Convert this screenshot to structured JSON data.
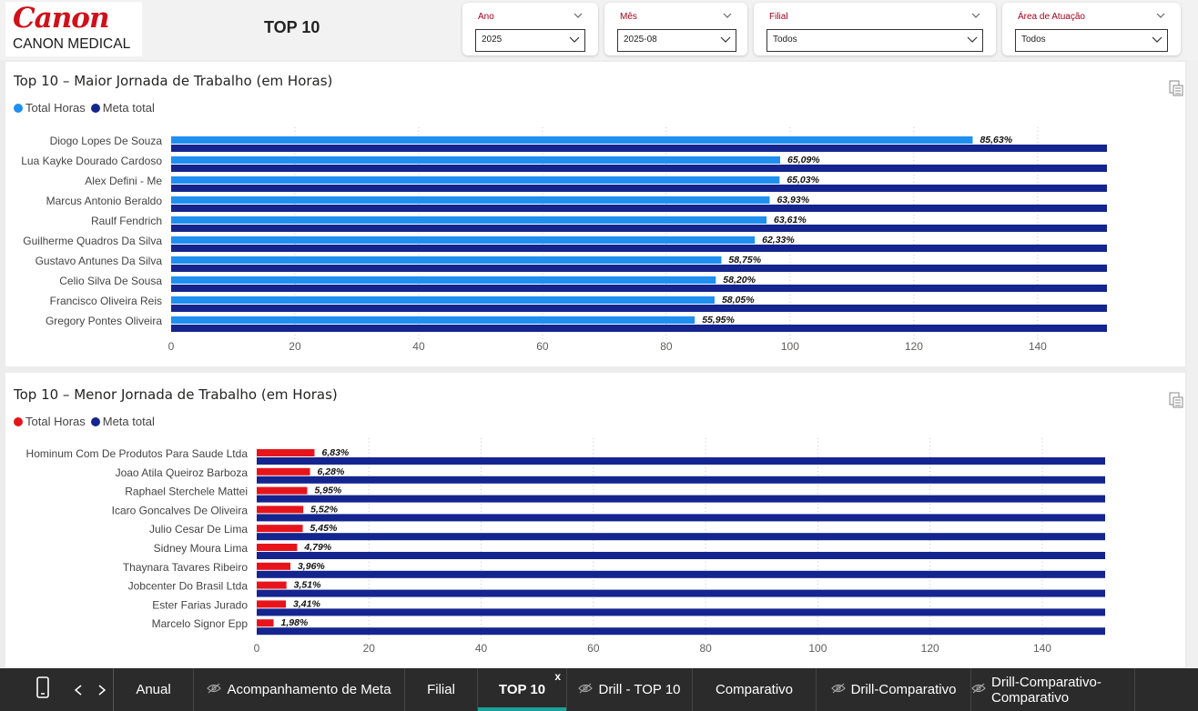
{
  "header": {
    "logo_brand": "Canon",
    "logo_sub": "CANON MEDICAL",
    "page_title": "TOP 10"
  },
  "filters": [
    {
      "label": "Ano",
      "value": "2025"
    },
    {
      "label": "Mês",
      "value": "2025-08"
    },
    {
      "label": "Filial",
      "value": "Todos"
    },
    {
      "label": "Área de Atuação",
      "value": "Todos"
    }
  ],
  "charts": {
    "top": {
      "title": "Top 10 – Maior Jornada de Trabalho (em Horas)",
      "legend": [
        "Total Horas",
        "Meta total"
      ]
    },
    "bottom": {
      "title": "Top 10 – Menor Jornada de Trabalho (em Horas)",
      "legend": [
        "Total Horas",
        "Meta total"
      ]
    }
  },
  "chart_data": [
    {
      "type": "bar",
      "orientation": "horizontal",
      "title": "Top 10 – Maior Jornada de Trabalho (em Horas)",
      "categories": [
        "Diogo Lopes De Souza",
        "Lua Kayke Dourado Cardoso",
        "Alex Defini - Me",
        "Marcus Antonio Beraldo",
        "Raulf Fendrich",
        "Guilherme Quadros Da Silva",
        "Gustavo Antunes Da Silva",
        "Celio Silva De Sousa",
        "Francisco Oliveira Reis",
        "Gregory Pontes Oliveira"
      ],
      "series": [
        {
          "name": "Total Horas",
          "color": "#1f8ff0",
          "values": [
            129.5,
            98.4,
            98.3,
            96.7,
            96.2,
            94.3,
            88.9,
            88.0,
            87.8,
            84.6
          ]
        },
        {
          "name": "Meta total",
          "color": "#14258f",
          "values": [
            151.2,
            151.2,
            151.2,
            151.2,
            151.2,
            151.2,
            151.2,
            151.2,
            151.2,
            151.2
          ]
        }
      ],
      "data_labels": [
        "85,63%",
        "65,09%",
        "65,03%",
        "63,93%",
        "63,61%",
        "62,33%",
        "58,75%",
        "58,20%",
        "58,05%",
        "55,95%"
      ],
      "xticks": [
        0,
        20,
        40,
        60,
        80,
        100,
        120,
        140
      ],
      "xlim": [
        0,
        151.2
      ]
    },
    {
      "type": "bar",
      "orientation": "horizontal",
      "title": "Top 10 – Menor Jornada de Trabalho (em Horas)",
      "categories": [
        "Hominum Com De Produtos Para Saude Ltda",
        "Joao Atila Queiroz Barboza",
        "Raphael Sterchele Mattei",
        "Icaro Goncalves De Oliveira",
        "Julio Cesar De Lima",
        "Sidney Moura Lima",
        "Thaynara Tavares Ribeiro",
        "Jobcenter Do Brasil Ltda",
        "Ester Farias Jurado",
        "Marcelo Signor Epp"
      ],
      "series": [
        {
          "name": "Total Horas",
          "color": "#e8141b",
          "values": [
            10.3,
            9.5,
            9.0,
            8.3,
            8.2,
            7.2,
            6.0,
            5.3,
            5.2,
            3.0
          ]
        },
        {
          "name": "Meta total",
          "color": "#14258f",
          "values": [
            151.2,
            151.2,
            151.2,
            151.2,
            151.2,
            151.2,
            151.2,
            151.2,
            151.2,
            151.2
          ]
        }
      ],
      "data_labels": [
        "6,83%",
        "6,28%",
        "5,95%",
        "5,52%",
        "5,45%",
        "4,79%",
        "3,96%",
        "3,51%",
        "3,41%",
        "1,98%"
      ],
      "xticks": [
        0,
        20,
        40,
        60,
        80,
        100,
        120,
        140
      ],
      "xlim": [
        0,
        151.2
      ]
    }
  ],
  "tabs": [
    {
      "label": "Anual",
      "hidden": false,
      "active": false
    },
    {
      "label": "Acompanhamento de Meta",
      "hidden": true,
      "active": false
    },
    {
      "label": "Filial",
      "hidden": false,
      "active": false
    },
    {
      "label": "TOP 10",
      "hidden": false,
      "active": true,
      "close": "x"
    },
    {
      "label": "Drill - TOP 10",
      "hidden": true,
      "active": false
    },
    {
      "label": "Comparativo",
      "hidden": false,
      "active": false
    },
    {
      "label": "Drill-Comparativo",
      "hidden": true,
      "active": false
    },
    {
      "label": "Drill-Comparativo-Comparativo",
      "hidden": true,
      "active": false
    }
  ]
}
